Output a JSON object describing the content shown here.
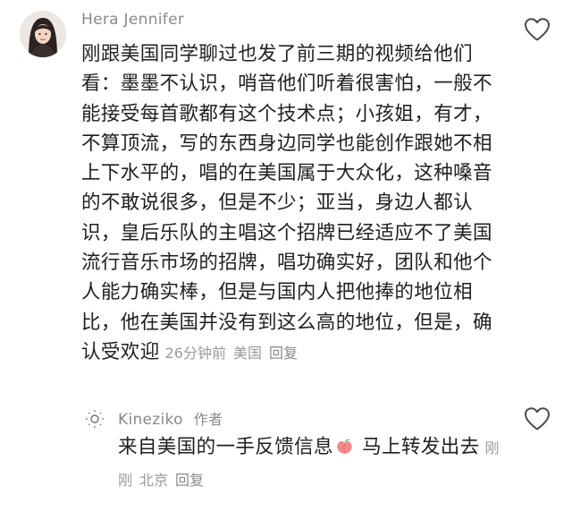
{
  "main_comment": {
    "author": "Hera Jennifer",
    "text": "刚跟美国同学聊过也发了前三期的视频给他们看：墨墨不认识，哨音他们听着很害怕，一般不能接受每首歌都有这个技术点；小孩姐，有才，不算顶流，写的东西身边同学也能创作跟她不相上下水平的，唱的在美国属于大众化，这种嗓音的不敢说很多，但是不少；亚当，身边人都认识，皇后乐队的主唱这个招牌已经适应不了美国流行音乐市场的招牌，唱功确实好，团队和他个人能力确实棒，但是与国内人把他捧的地位相比，他在美国并没有到这么高的地位，但是，确认受欢迎",
    "time": "26分钟前",
    "location": "美国",
    "reply_label": "回复",
    "avatar_icon": "user-avatar-icon",
    "like_icon": "heart-outline-icon"
  },
  "reply_comment": {
    "author": "Kineziko",
    "author_tag": "作者",
    "text_before": "来自美国的一手反馈信息",
    "emoji": "peach-emoji-icon",
    "text_after": " 马上转发出去",
    "time": "刚刚",
    "location": "北京",
    "reply_label": "回复",
    "avatar_icon": "sun-avatar-icon",
    "like_icon": "heart-outline-icon"
  },
  "colors": {
    "text": "#1f1f1f",
    "secondary": "#8a8a8a",
    "meta": "#9a9a9a",
    "background": "#ffffff"
  }
}
